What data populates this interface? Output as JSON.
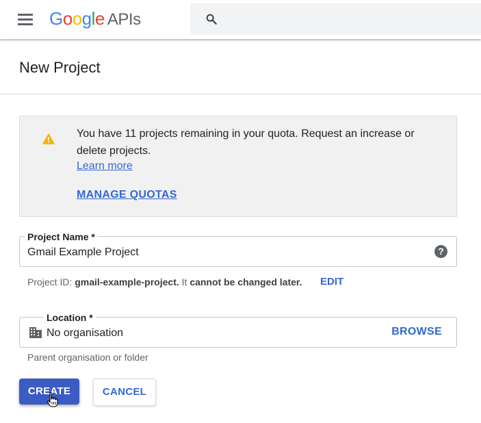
{
  "header": {
    "logo": {
      "letters": [
        {
          "char": "G",
          "color": "#4285F4"
        },
        {
          "char": "o",
          "color": "#EA4335"
        },
        {
          "char": "o",
          "color": "#FBBC05"
        },
        {
          "char": "g",
          "color": "#4285F4"
        },
        {
          "char": "l",
          "color": "#34A853"
        },
        {
          "char": "e",
          "color": "#EA4335"
        }
      ],
      "suffix": "APIs"
    },
    "menu_icon": "hamburger-menu-icon",
    "search_icon": "search-icon"
  },
  "page": {
    "title": "New Project"
  },
  "quota_notice": {
    "icon": "warning-icon",
    "icon_color": "#F4B400",
    "message": "You have 11 projects remaining in your quota. Request an increase or delete projects.",
    "learn_more": "Learn more",
    "manage_quotas": "MANAGE QUOTAS"
  },
  "project_name": {
    "label": "Project Name *",
    "value": "Gmail Example Project",
    "help_icon": "?"
  },
  "project_id": {
    "prefix": "Project ID: ",
    "id": "gmail-example-project.",
    "suffix": " It ",
    "note": "cannot be changed later.",
    "edit": "EDIT"
  },
  "location": {
    "label": "Location *",
    "icon": "organisation-building-icon",
    "value": "No organisation",
    "browse": "BROWSE",
    "helper": "Parent organisation or folder"
  },
  "actions": {
    "create": "CREATE",
    "cancel": "CANCEL"
  },
  "colors": {
    "accent": "#3367d6",
    "create_button": "#3b5cc4"
  }
}
